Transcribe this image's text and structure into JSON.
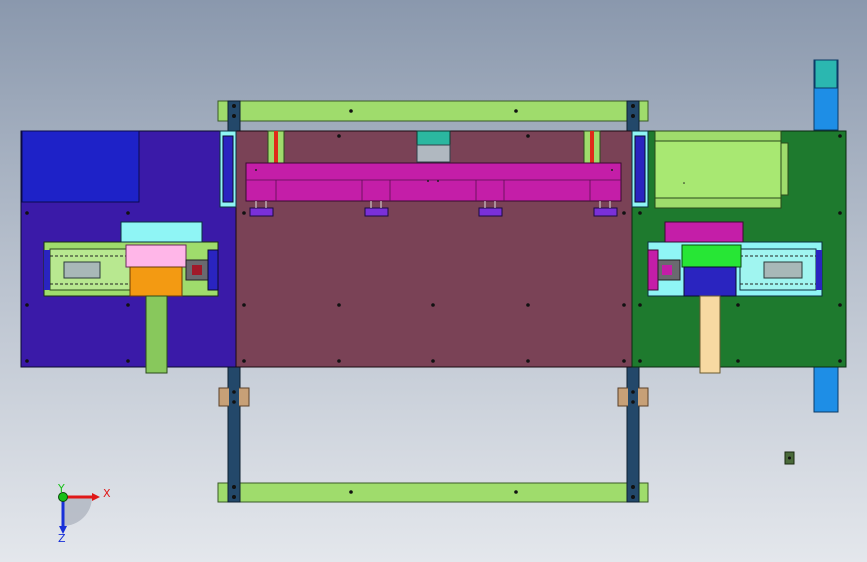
{
  "viewport": {
    "background_top": "#8a98ad",
    "background_bottom": "#e4e7ec"
  },
  "colors": {
    "left_plate": "#3a1aa8",
    "left_block": "#1e22c8",
    "center_plate": "#7a4256",
    "right_plate": "#1e7a2e",
    "rail_green": "#9fdc6c",
    "column": "#23486a",
    "top_beam": "#c41ea8",
    "cyan_part": "#8ff5f5",
    "pink_part": "#ffb6e8",
    "orange_part": "#f39a12",
    "blue_part": "#2a24c0",
    "bright_green": "#27e635",
    "tan_part": "#f7d9a2",
    "slide_green": "#88c85c",
    "right_post": "#1e8ee6",
    "bolt": "#111111",
    "bracket": "#c7a077"
  },
  "icons": {
    "triad": "coordinate-triad-icon"
  },
  "triad": {
    "x_label": "X",
    "y_label": "Y",
    "z_label": "Z",
    "x_color": "#e01818",
    "y_color": "#18c018",
    "z_color": "#1830d8"
  }
}
